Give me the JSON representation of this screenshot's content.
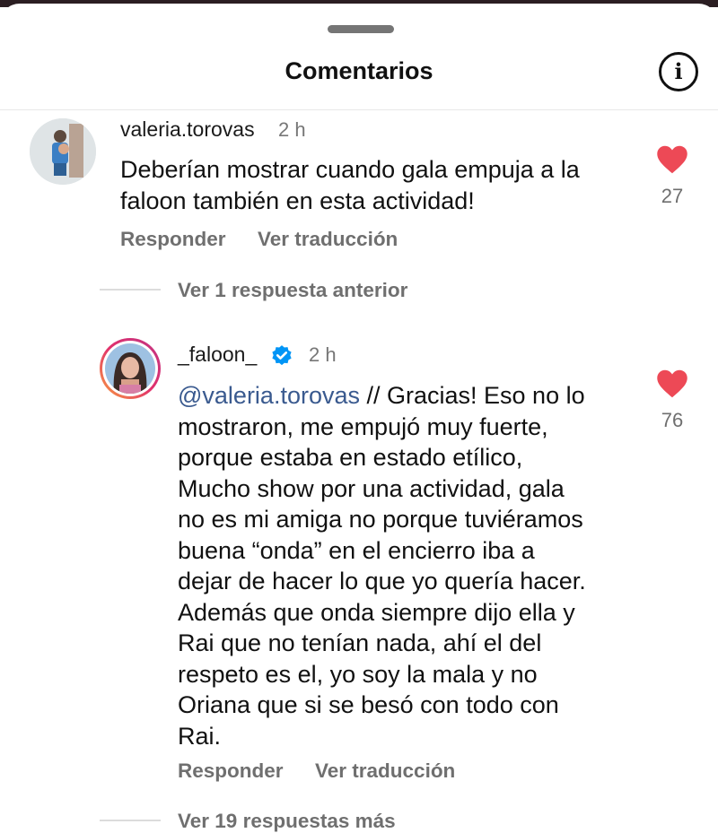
{
  "sheet": {
    "title": "Comentarios",
    "info_icon": "info-icon"
  },
  "comments": [
    {
      "username": "valeria.torovas",
      "time": "2 h",
      "text_lines": [
        "Deberían mostrar cuando gala empuja a la",
        "faloon también en esta actividad!"
      ],
      "likes": "27",
      "reply_label": "Responder",
      "translate_label": "Ver traducción"
    },
    {
      "username": "_faloon_",
      "verified": true,
      "time": "2 h",
      "mention": "@valeria.torovas",
      "text_first_rest": " // Gracias! Eso no lo",
      "text_lines": [
        "mostraron, me empujó muy fuerte,",
        "porque estaba en estado etílico,",
        "Mucho show por una actividad, gala",
        "no es mi amiga no porque tuviéramos",
        "buena “onda” en el encierro iba a",
        "dejar de hacer lo que yo quería hacer.",
        "Además que onda siempre dijo ella y",
        "Rai que no tenían nada, ahí el del",
        "respeto es el, yo soy la mala y no",
        "Oriana que si se besó con todo con",
        "Rai."
      ],
      "likes": "76",
      "reply_label": "Responder",
      "translate_label": "Ver traducción"
    }
  ],
  "threads": {
    "previous_replies": "Ver 1 respuesta anterior",
    "more_replies": "Ver 19 respuestas más"
  },
  "colors": {
    "heart": "#ed4956",
    "verified": "#0095f6",
    "mention": "#3a5a8f"
  }
}
